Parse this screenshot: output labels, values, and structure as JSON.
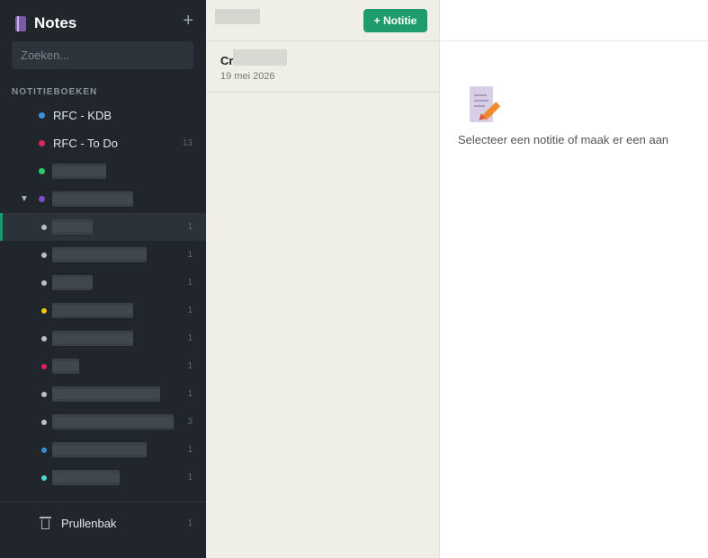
{
  "app": {
    "title": "Notes",
    "add_notebook_icon": "plus-icon"
  },
  "search": {
    "placeholder": "Zoeken..."
  },
  "sidebar": {
    "section_label": "NOTITIEBOEKEN",
    "notebooks": [
      {
        "label": "RFC - KDB",
        "color": "#3b8fd6",
        "count": ""
      },
      {
        "label": "RFC - To Do",
        "color": "#e0245e",
        "count": "13"
      }
    ],
    "trash": {
      "label": "Prullenbak",
      "count": "1"
    }
  },
  "notes_list": {
    "new_note_label": "+ Notitie",
    "notes": [
      {
        "title_prefix": "Cr",
        "date": "19 mei 2026"
      }
    ]
  },
  "editor": {
    "empty_message": "Selecteer een notitie of maak er een aan",
    "empty_icon": "memo-icon"
  }
}
